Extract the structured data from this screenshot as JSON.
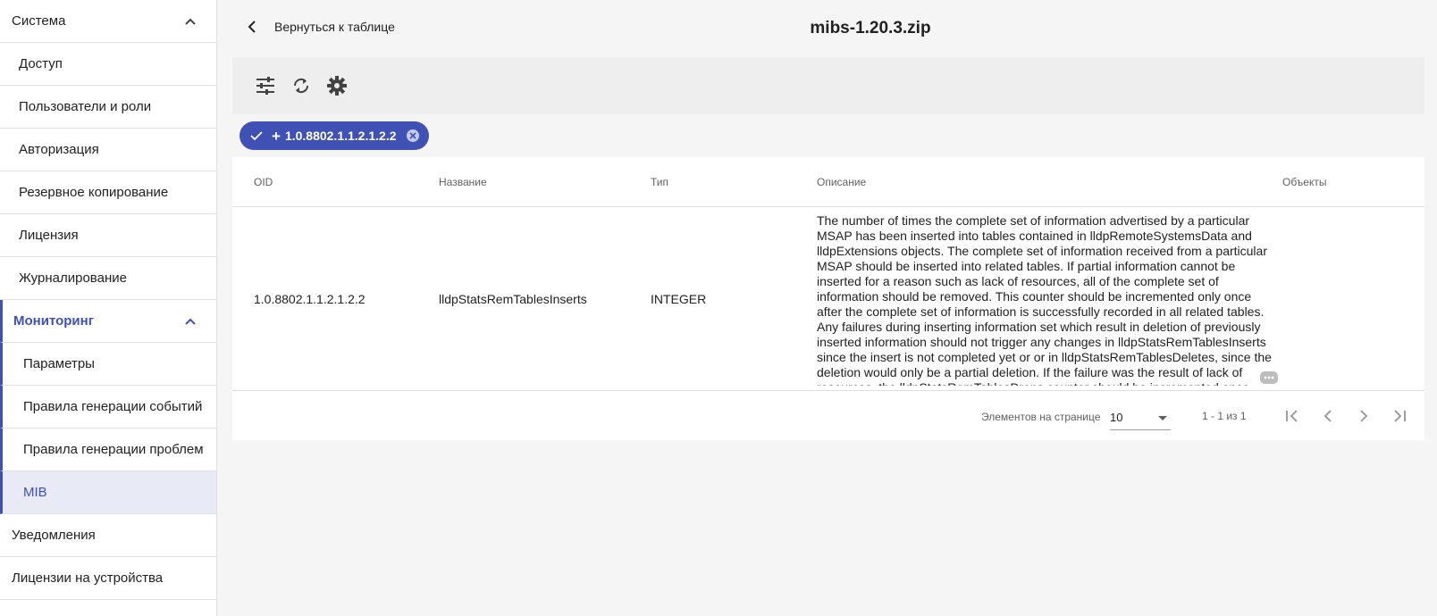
{
  "sidebar": {
    "group_system": "Система",
    "system_items": [
      "Доступ",
      "Пользователи и роли",
      "Авторизация",
      "Резервное копирование",
      "Лицензия",
      "Журналирование"
    ],
    "group_monitoring": "Мониторинг",
    "monitoring_items": [
      "Параметры",
      "Правила генерации событий",
      "Правила генерации проблем",
      "MIB"
    ],
    "group_notifications": "Уведомления",
    "group_device_licenses": "Лицензии на устройства"
  },
  "header": {
    "back_label": "Вернуться к таблице",
    "title": "mibs-1.20.3.zip"
  },
  "filter_chip": {
    "label": "1.0.8802.1.1.2.1.2.2"
  },
  "table": {
    "columns": [
      "OID",
      "Название",
      "Тип",
      "Описание",
      "Объекты"
    ],
    "rows": [
      {
        "oid": "1.0.8802.1.1.2.1.2.2",
        "name": "lldpStatsRemTablesInserts",
        "type": "INTEGER",
        "description": "The number of times the complete set of information advertised by a particular MSAP has been inserted into tables contained in lldpRemoteSystemsData and lldpExtensions objects. The complete set of information received from a particular MSAP should be inserted into related tables. If partial information cannot be inserted for a reason such as lack of resources, all of the complete set of information should be removed. This counter should be incremented only once after the complete set of information is successfully recorded in all related tables. Any failures during inserting information set which result in deletion of previously inserted information should not trigger any changes in lldpStatsRemTablesInserts since the insert is not completed yet or or in lldpStatsRemTablesDeletes, since the deletion would only be a partial deletion. If the failure was the result of lack of resources, the lldpStatsRemTablesDrops counter should be incremented once.",
        "objects": ""
      }
    ]
  },
  "paginator": {
    "items_per_page_label": "Элементов на странице",
    "page_size": "10",
    "range_label": "1 - 1 из 1"
  },
  "colors": {
    "accent": "#3f51b5",
    "active_bg": "#e8eaf6"
  }
}
